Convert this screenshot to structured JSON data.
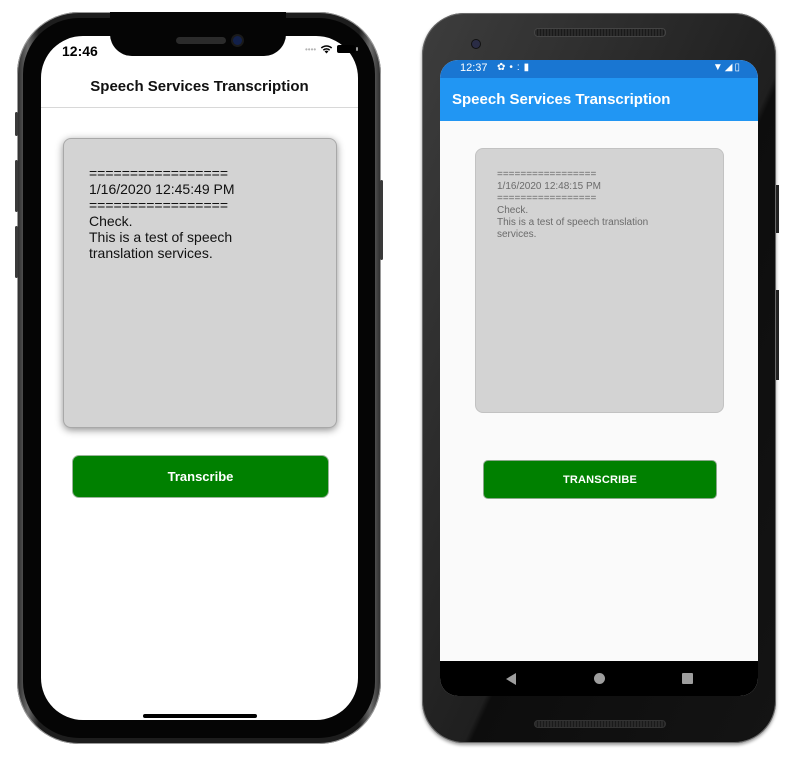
{
  "ios": {
    "status_time": "12:46",
    "signal_icon": "signal-dots-icon",
    "wifi_icon": "wifi-icon",
    "battery_icon": "battery-icon",
    "nav_title": "Speech Services Transcription",
    "transcript": {
      "separator_top": "=================",
      "timestamp": "1/16/2020 12:45:49 PM",
      "separator_bottom": "=================",
      "lines": "Check.\nThis is a test of speech\ntranslation services."
    },
    "button_label": "Transcribe",
    "colors": {
      "button": "#008000",
      "card": "#d3d3d3"
    }
  },
  "android": {
    "status_time": "12:37",
    "status_icons": [
      "settings-icon",
      "notification-icon",
      "sd-card-icon"
    ],
    "status_right_icons": [
      "wifi-icon",
      "cell-signal-icon",
      "battery-icon"
    ],
    "app_title": "Speech Services Transcription",
    "transcript": {
      "separator_top": "=================",
      "timestamp": "1/16/2020 12:48:15 PM",
      "separator_bottom": "=================",
      "lines": "Check.\nThis is a test of speech translation\nservices."
    },
    "button_label": "TRANSCRIBE",
    "nav": [
      "back",
      "home",
      "recents"
    ],
    "colors": {
      "status_bar": "#1976d2",
      "app_bar": "#2196f3",
      "button": "#008000",
      "card": "#d3d3d3"
    }
  }
}
